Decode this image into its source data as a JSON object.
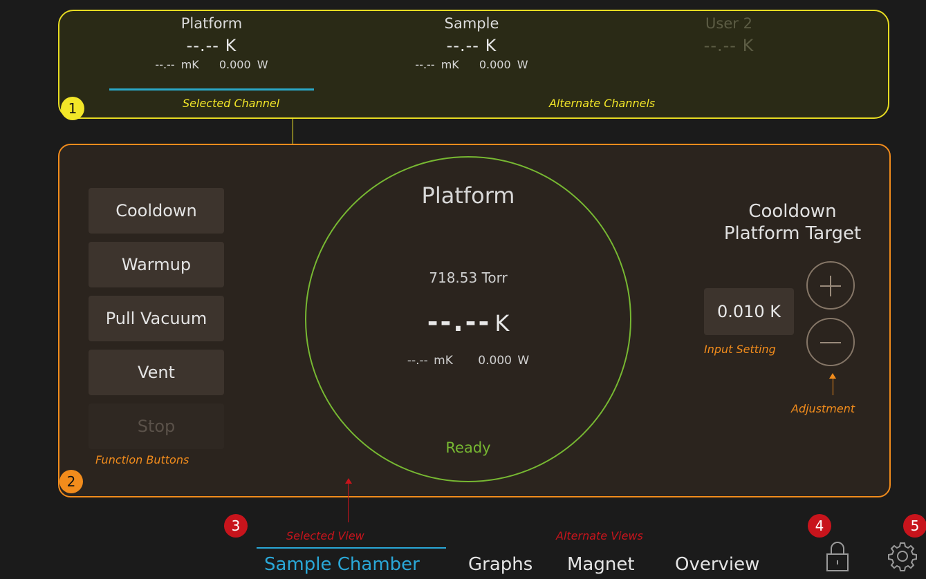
{
  "channels": {
    "selected": {
      "name": "Platform",
      "temp": "--.-- K",
      "mk": "--.-- mK",
      "power": "0.000 W"
    },
    "alternates": [
      {
        "name": "Sample",
        "temp": "--.-- K",
        "mk": "--.-- mK",
        "power": "0.000 W"
      },
      {
        "name": "User 2",
        "temp": "--.-- K"
      }
    ],
    "label_selected": "Selected Channel",
    "label_alternate": "Alternate Channels",
    "badge": "1"
  },
  "main": {
    "badge": "2",
    "function_buttons": [
      {
        "label": "Cooldown",
        "enabled": true
      },
      {
        "label": "Warmup",
        "enabled": true
      },
      {
        "label": "Pull Vacuum",
        "enabled": true
      },
      {
        "label": "Vent",
        "enabled": true
      },
      {
        "label": "Stop",
        "enabled": false
      }
    ],
    "function_buttons_label": "Function Buttons",
    "gauge": {
      "title": "Platform",
      "pressure": "718.53 Torr",
      "temp_value": "--.--",
      "temp_unit": "K",
      "mk": "--.-- mK",
      "power": "0.000 W",
      "status": "Ready"
    },
    "target": {
      "title_line1": "Cooldown",
      "title_line2": "Platform Target",
      "value": "0.010 K",
      "input_label": "Input Setting",
      "adjust_label": "Adjustment"
    }
  },
  "nav": {
    "badge": "3",
    "label_selected": "Selected View",
    "label_alternate": "Alternate Views",
    "items": [
      "Sample Chamber",
      "Graphs",
      "Magnet",
      "Overview"
    ],
    "selected_index": 0
  },
  "lock": {
    "badge": "4"
  },
  "settings": {
    "badge": "5"
  },
  "colors": {
    "channel_border": "#e7dc22",
    "main_border": "#f28c1c",
    "gauge_ring": "#77b832",
    "selected_blue": "#2aa8d8",
    "annotation_red": "#c8141c"
  }
}
